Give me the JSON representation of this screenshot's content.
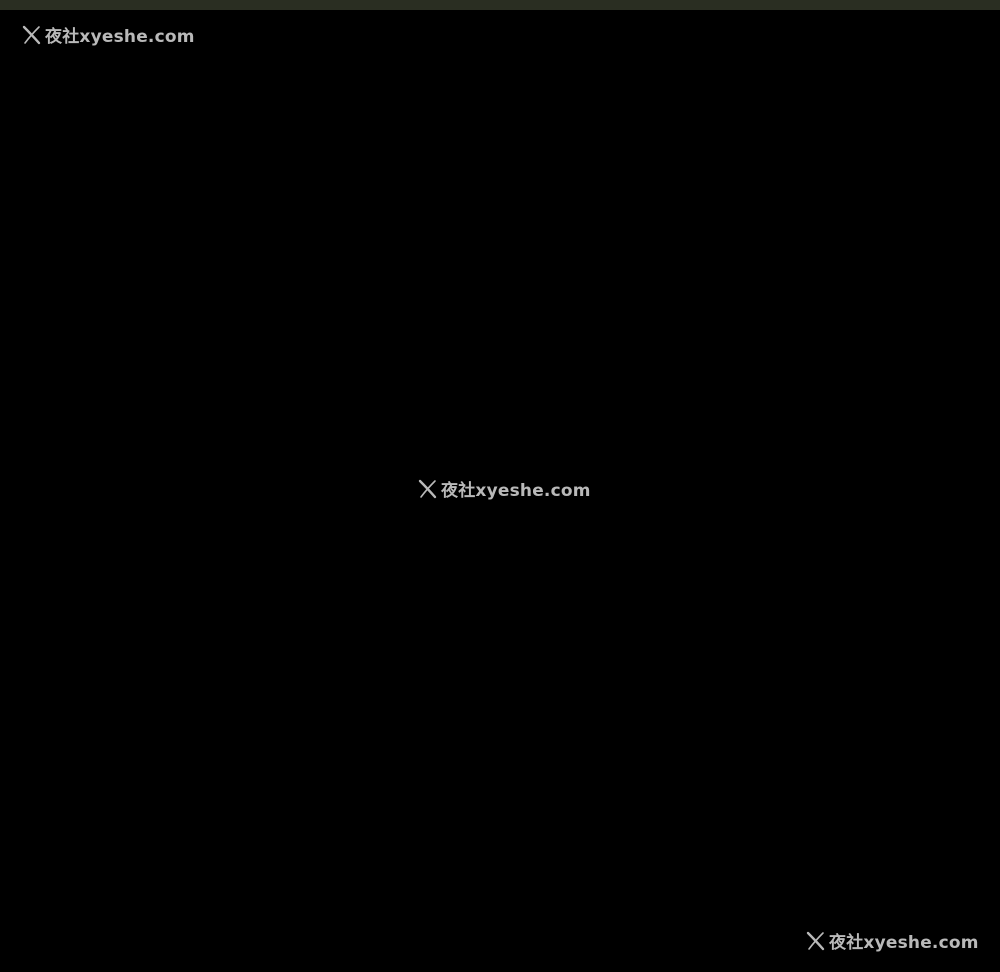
{
  "colors": {
    "background": "#000000",
    "top_strip": "#2a2e22",
    "watermark_text": "#c9c9c9"
  },
  "watermarks": [
    {
      "icon": "x-logo-icon",
      "text": "夜社xyeshe.com"
    },
    {
      "icon": "x-logo-icon",
      "text": "夜社xyeshe.com"
    },
    {
      "icon": "x-logo-icon",
      "text": "夜社xyeshe.com"
    }
  ]
}
